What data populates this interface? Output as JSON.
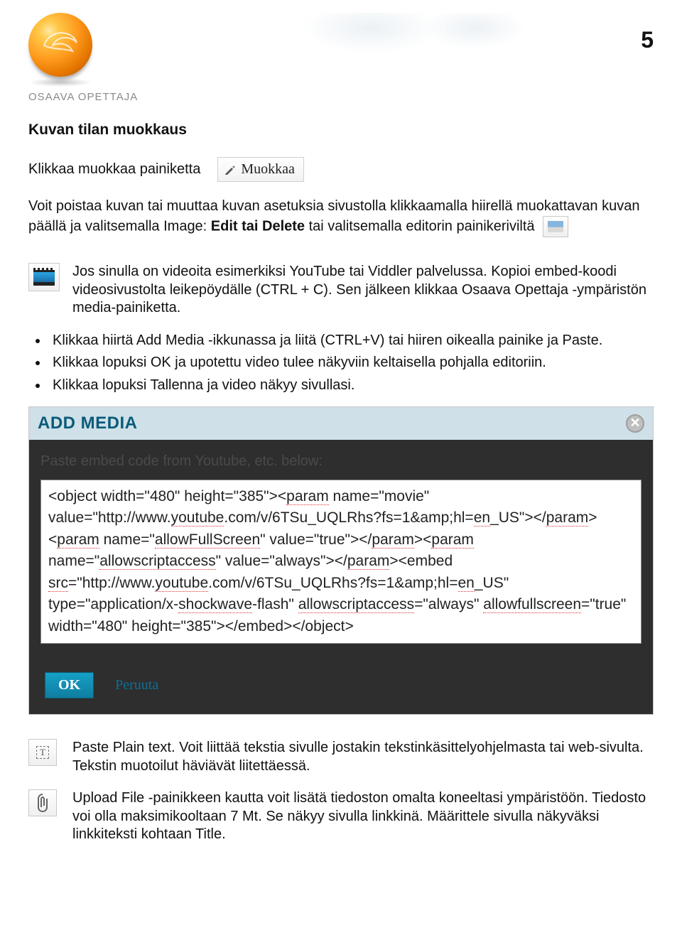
{
  "page_number": "5",
  "logo_text": "OSAAVA OPETTAJA",
  "section_title": "Kuvan tilan muokkaus",
  "line_click_edit": "Klikkaa muokkaa painiketta",
  "muokkaa_button_label": "Muokkaa",
  "para_intro_1": "Voit poistaa kuvan tai muuttaa kuvan asetuksia sivustolla klikkaamalla hiirellä muokattavan kuvan päällä ja valitsemalla Image: ",
  "para_intro_bold": "Edit tai Delete",
  "para_intro_2": " tai valitsemalla editorin painikeriviltä",
  "video_para": "Jos sinulla on videoita esimerkiksi YouTube tai Viddler palvelussa. Kopioi embed-koodi videosivustolta leikepöydälle (CTRL + C). Sen jälkeen klikkaa Osaava Opettaja -ympäristön media-painiketta.",
  "bullets": [
    "Klikkaa hiirtä Add Media -ikkunassa ja liitä (CTRL+V) tai hiiren oikealla painike ja Paste.",
    "Klikkaa lopuksi OK ja upotettu video tulee näkyviin keltaisella pohjalla editoriin.",
    "Klikkaa lopuksi Tallenna ja video näkyy sivullasi."
  ],
  "dialog": {
    "title": "ADD MEDIA",
    "hint": "Paste embed code from Youtube, etc. below:",
    "embed_code": "<object width=\"480\" height=\"385\"><param name=\"movie\" value=\"http://www.youtube.com/v/6TSu_UQLRhs?fs=1&amp;hl=en_US\"></param><param name=\"allowFullScreen\" value=\"true\"></param><param name=\"allowscriptaccess\" value=\"always\"></param><embed src=\"http://www.youtube.com/v/6TSu_UQLRhs?fs=1&amp;hl=en_US\" type=\"application/x-shockwave-flash\" allowscriptaccess=\"always\" allowfullscreen=\"true\" width=\"480\" height=\"385\"></embed></object>",
    "ok": "OK",
    "cancel": "Peruuta"
  },
  "paste_plain": "Paste Plain text. Voit liittää tekstia sivulle jostakin tekstinkäsittelyohjelmasta tai web-sivulta. Tekstin muotoilut häviävät liitettäessä.",
  "upload_file": "Upload File -painikkeen kautta voit lisätä tiedoston omalta koneeltasi ympäristöön. Tiedosto voi olla maksimikooltaan 7 Mt. Se näkyy sivulla linkkinä. Määrittele sivulla näkyväksi linkkiteksti kohtaan Title."
}
